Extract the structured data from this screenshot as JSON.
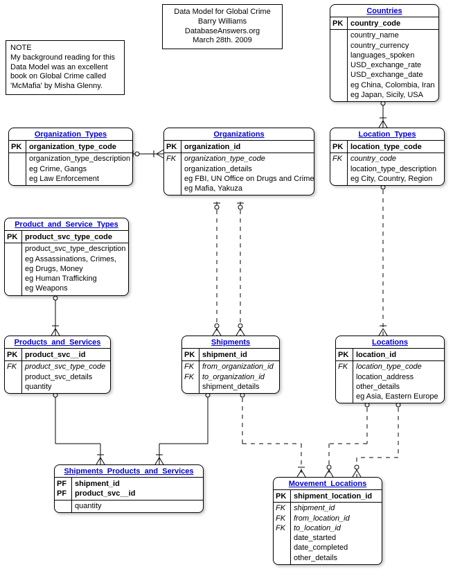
{
  "header": {
    "line1": "Data Model for Global Crime",
    "line2": "Barry Williams",
    "line3": "DatabaseAnswers.org",
    "line4": "March 28th. 2009"
  },
  "note": {
    "title": "NOTE",
    "line1": "My background reading for this",
    "line2": "Data Model was an excellent",
    "line3": "book on Global Crime called",
    "line4": "'McMafia' by Misha Glenny."
  },
  "entities": {
    "countries": {
      "title": "Countries",
      "rows": [
        {
          "key": "PK",
          "attr": "country_code",
          "type": "pk"
        },
        {
          "key": "",
          "attr": "country_name",
          "type": ""
        },
        {
          "key": "",
          "attr": "country_currency",
          "type": ""
        },
        {
          "key": "",
          "attr": "languages_spoken",
          "type": ""
        },
        {
          "key": "",
          "attr": "USD_exchange_rate",
          "type": ""
        },
        {
          "key": "",
          "attr": "USD_exchange_date",
          "type": ""
        },
        {
          "key": "",
          "attr": "eg China, Colombia, Iran",
          "type": ""
        },
        {
          "key": "",
          "attr": "eg Japan, Sicily,  USA",
          "type": ""
        }
      ]
    },
    "location_types": {
      "title": "Location_Types",
      "rows": [
        {
          "key": "PK",
          "attr": "location_type_code",
          "type": "pk"
        },
        {
          "key": "FK",
          "attr": "country_code",
          "type": "fk"
        },
        {
          "key": "",
          "attr": "location_type_description",
          "type": ""
        },
        {
          "key": "",
          "attr": "eg City, Country, Region",
          "type": ""
        }
      ]
    },
    "organization_types": {
      "title": "Organization_Types",
      "rows": [
        {
          "key": "PK",
          "attr": "organization_type_code",
          "type": "pk"
        },
        {
          "key": "",
          "attr": "organization_type_description",
          "type": ""
        },
        {
          "key": "",
          "attr": "eg Crime, Gangs",
          "type": ""
        },
        {
          "key": "",
          "attr": "eg Law Enforcement",
          "type": ""
        }
      ]
    },
    "organizations": {
      "title": "Organizations",
      "rows": [
        {
          "key": "PK",
          "attr": "organization_id",
          "type": "pk"
        },
        {
          "key": "FK",
          "attr": "organization_type_code",
          "type": "fk"
        },
        {
          "key": "",
          "attr": "organization_details",
          "type": ""
        },
        {
          "key": "",
          "attr": "eg FBI, UN Office on Drugs and Crime",
          "type": ""
        },
        {
          "key": "",
          "attr": "eg Mafia, Yakuza",
          "type": ""
        }
      ]
    },
    "product_and_service_types": {
      "title": "Product_and_Service_Types",
      "rows": [
        {
          "key": "PK",
          "attr": "product_svc_type_code",
          "type": "pk"
        },
        {
          "key": "",
          "attr": "product_svc_type_description",
          "type": ""
        },
        {
          "key": "",
          "attr": "eg Assassinations, Crimes,",
          "type": ""
        },
        {
          "key": "",
          "attr": "eg Drugs, Money",
          "type": ""
        },
        {
          "key": "",
          "attr": "eg Human Trafficking",
          "type": ""
        },
        {
          "key": "",
          "attr": "eg Weapons",
          "type": ""
        }
      ]
    },
    "products_and_services": {
      "title": "Products_and_Services",
      "rows": [
        {
          "key": "PK",
          "attr": "product_svc__id",
          "type": "pk"
        },
        {
          "key": "FK",
          "attr": "product_svc_type_code",
          "type": "fk"
        },
        {
          "key": "",
          "attr": "product_svc_details",
          "type": ""
        },
        {
          "key": "",
          "attr": "quantity",
          "type": ""
        }
      ]
    },
    "shipments": {
      "title": "Shipments",
      "rows": [
        {
          "key": "PK",
          "attr": "shipment_id",
          "type": "pk"
        },
        {
          "key": "FK",
          "attr": "from_organization_id",
          "type": "fk"
        },
        {
          "key": "FK",
          "attr": "to_organization_id",
          "type": "fk"
        },
        {
          "key": "",
          "attr": "shipment_details",
          "type": ""
        }
      ]
    },
    "locations": {
      "title": "Locations",
      "rows": [
        {
          "key": "PK",
          "attr": "location_id",
          "type": "pk"
        },
        {
          "key": "FK",
          "attr": "location_type_code",
          "type": "fk"
        },
        {
          "key": "",
          "attr": "location_address",
          "type": ""
        },
        {
          "key": "",
          "attr": "other_details",
          "type": ""
        },
        {
          "key": "",
          "attr": "eg Asia, Eastern Europe",
          "type": ""
        }
      ]
    },
    "shipments_products_and_services": {
      "title": "Shipments_Products_and_Services",
      "rows": [
        {
          "key": "PF",
          "attr": "shipment_id",
          "type": "pf"
        },
        {
          "key": "PF",
          "attr": "product_svc__id",
          "type": "pf"
        },
        {
          "key": "",
          "attr": "quantity",
          "type": ""
        }
      ]
    },
    "movement_locations": {
      "title": "Movement_Locations",
      "rows": [
        {
          "key": "PK",
          "attr": "shipment_location_id",
          "type": "pk"
        },
        {
          "key": "FK",
          "attr": "shipment_id",
          "type": "fk"
        },
        {
          "key": "FK",
          "attr": "from_location_id",
          "type": "fk"
        },
        {
          "key": "FK",
          "attr": "to_location_id",
          "type": "fk"
        },
        {
          "key": "",
          "attr": "date_started",
          "type": ""
        },
        {
          "key": "",
          "attr": "date_completed",
          "type": ""
        },
        {
          "key": "",
          "attr": "other_details",
          "type": ""
        }
      ]
    }
  }
}
